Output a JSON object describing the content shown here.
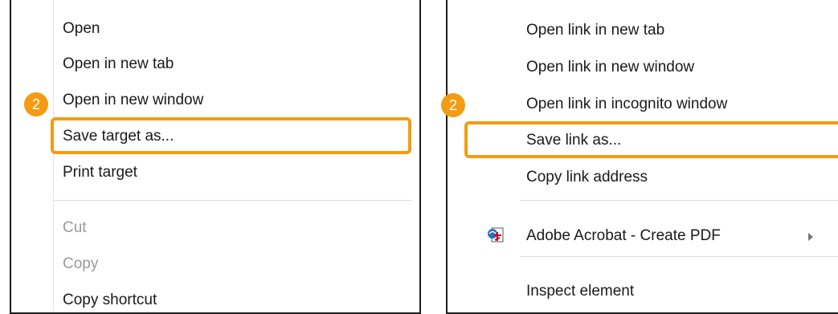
{
  "left_menu": {
    "items": [
      {
        "label": "Open",
        "enabled": true
      },
      {
        "label": "Open in new tab",
        "enabled": true
      },
      {
        "label": "Open in new window",
        "enabled": true
      },
      {
        "label": "Save target as...",
        "enabled": true
      },
      {
        "label": "Print target",
        "enabled": true
      },
      {
        "label": "Cut",
        "enabled": false
      },
      {
        "label": "Copy",
        "enabled": false
      },
      {
        "label": "Copy shortcut",
        "enabled": true
      }
    ],
    "step_badge": "2"
  },
  "right_menu": {
    "items": [
      {
        "label": "Open link in new tab"
      },
      {
        "label": "Open link in new window"
      },
      {
        "label": "Open link in incognito window"
      },
      {
        "label": "Save link as..."
      },
      {
        "label": "Copy link address"
      },
      {
        "label": "Adobe Acrobat - Create PDF",
        "icon": "adobe-pdf-icon",
        "has_submenu": true
      },
      {
        "label": "Inspect element"
      }
    ],
    "step_badge": "2"
  },
  "colors": {
    "highlight": "#f39c12",
    "disabled_text": "#9a9a9a",
    "border": "#1e1e1e"
  }
}
